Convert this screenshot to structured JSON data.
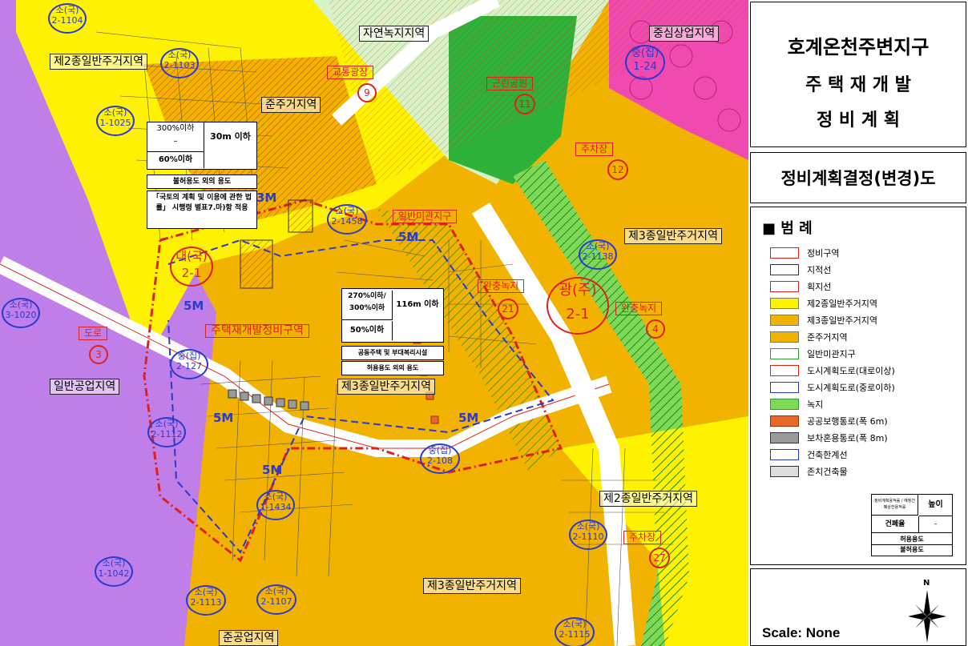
{
  "title": {
    "line1": "호계온천주변지구",
    "line2": "주 택 재 개 발",
    "line3": "정 비 계 획"
  },
  "subtitle": "정비계획결정(변경)도",
  "legend": {
    "heading": "■ 범  례",
    "items": [
      {
        "label": "정비구역",
        "swatch": "#ffffff",
        "border": "#e0201a"
      },
      {
        "label": "지적선",
        "swatch": "#ffffff",
        "border": "#333333"
      },
      {
        "label": "획지선",
        "swatch": "#ffffff",
        "border": "#e0201a"
      },
      {
        "label": "제2종일반주거지역",
        "swatch": "#fff200",
        "border": "#777"
      },
      {
        "label": "제3종일반주거지역",
        "swatch": "#f2b300",
        "border": "#777"
      },
      {
        "label": "준주거지역",
        "swatch": "#f2b300",
        "border": "#777"
      },
      {
        "label": "일반미관지구",
        "swatch": "#ffffff",
        "border": "#2e9e2e"
      },
      {
        "label": "도시계획도로(대로이상)",
        "swatch": "#ffffff",
        "border": "#e0201a"
      },
      {
        "label": "도시계획도로(중로이하)",
        "swatch": "#ffffff",
        "border": "#2a3ad0"
      },
      {
        "label": "녹지",
        "swatch": "#7fd858",
        "border": "#2e9e2e"
      },
      {
        "label": "공공보행통로(폭 6m)",
        "swatch": "#e4692a",
        "border": "#a03000"
      },
      {
        "label": "보차혼용통로(폭 8m)",
        "swatch": "#9a9a9a",
        "border": "#333"
      },
      {
        "label": "건축한계선",
        "swatch": "#ffffff",
        "border": "#2a3ad0"
      },
      {
        "label": "존치건축물",
        "swatch": "#dddddd",
        "border": "#333"
      }
    ],
    "table": {
      "r1c1": "정비계획용적률 / 예정건폐상한용적률",
      "r1c2": "높이",
      "r2c1": "건폐율",
      "r2c2": "–",
      "r3": "허용용도",
      "r4": "불허용도"
    }
  },
  "scale": "Scale: None",
  "north": "N",
  "map": {
    "zones": {
      "z2_top": "제2종일반주거지역",
      "nature": "자연녹지지역",
      "commercial": "중심상업지역",
      "semi": "준주거지역",
      "z3_right": "제3종일반주거지역",
      "industrial": "일반공업지역",
      "z3_center": "제3종일반주거지역",
      "z2_bottom": "제2종일반주거지역",
      "z3_bottom": "제3종일반주거지역",
      "semi_industrial": "준공업지역"
    },
    "red_labels": {
      "traffic": "교통광장",
      "park": "근린공원",
      "parking1": "주차장",
      "buffer": "완충녹지",
      "district": "주택재개발정비구역",
      "road": "도로",
      "aesthetic": "일반미관지구",
      "buffer2": "완충녹지",
      "parking2": "주차장"
    },
    "red_nums": {
      "n9": "9",
      "n11": "11",
      "n12": "12",
      "n4": "4",
      "n3": "3",
      "n21": "21",
      "n27": "27"
    },
    "circles": [
      {
        "top": "소(국)",
        "bot": "2-1104"
      },
      {
        "top": "소(국)",
        "bot": "2-1103"
      },
      {
        "top": "소(국)",
        "bot": "1-1025"
      },
      {
        "top": "중(집)",
        "bot": "1-24"
      },
      {
        "top": "소(국)",
        "bot": "2-1458"
      },
      {
        "top": "소(국)",
        "bot": "2-1138"
      },
      {
        "top": "소(국)",
        "bot": "3-1020"
      },
      {
        "top": "중(집)",
        "bot": "2-127"
      },
      {
        "top": "소(국)",
        "bot": "2-1112"
      },
      {
        "top": "중(집)",
        "bot": "2-108"
      },
      {
        "top": "소(국)",
        "bot": "1-1434"
      },
      {
        "top": "소(국)",
        "bot": "2-1110"
      },
      {
        "top": "소(국)",
        "bot": "1-1042"
      },
      {
        "top": "소(국)",
        "bot": "2-1113"
      },
      {
        "top": "소(국)",
        "bot": "2-1107"
      },
      {
        "top": "소(국)",
        "bot": "2-1115"
      }
    ],
    "big_circles": {
      "c1": {
        "top": "대(국)",
        "bot": "2-1"
      },
      "c2": {
        "top": "광(주)",
        "bot": "2-1"
      }
    },
    "setbacks": {
      "a": "3M",
      "b": "5M",
      "c": "5M",
      "d": "5M",
      "e": "5M",
      "f": "5M"
    },
    "box1": {
      "far": "300%이하",
      "height": "30m 이하",
      "bcr": "60%이하",
      "ban": "불허용도 외의 용도",
      "note": "「국토의 계획 및 이용에 관한 법률」 시행령 별표7.마)항 적용"
    },
    "box2": {
      "far1": "270%이하/",
      "far2": "300%이하",
      "height": "116m 이하",
      "bcr": "50%이하",
      "use": "공동주택 및 부대복리시설",
      "ban": "허용용도 외의 용도"
    }
  }
}
